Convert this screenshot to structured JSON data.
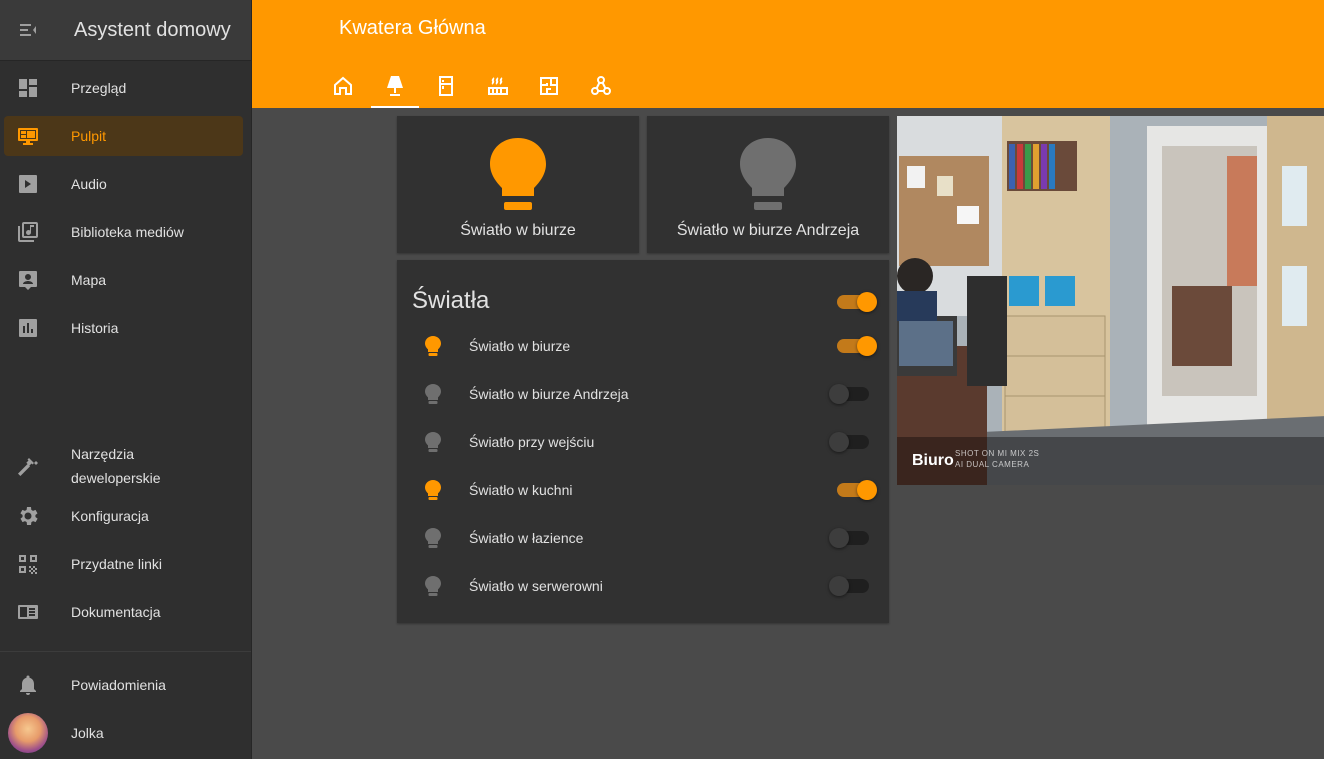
{
  "app": {
    "title": "Asystent domowy"
  },
  "sidebar": {
    "items": [
      {
        "label": "Przegląd",
        "icon": "dashboard-icon"
      },
      {
        "label": "Pulpit",
        "icon": "monitor-dashboard-icon",
        "active": true
      },
      {
        "label": "Audio",
        "icon": "play-box-icon"
      },
      {
        "label": "Biblioteka mediów",
        "icon": "library-music-icon"
      },
      {
        "label": "Mapa",
        "icon": "account-box-icon"
      },
      {
        "label": "Historia",
        "icon": "chart-box-icon"
      }
    ],
    "bottom_items": [
      {
        "label_line1": "Narzędzia",
        "label_line2": "deweloperskie",
        "icon": "hammer-icon"
      },
      {
        "label": "Konfiguracja",
        "icon": "gear-icon"
      },
      {
        "label": "Przydatne linki",
        "icon": "qrcode-icon"
      },
      {
        "label": "Dokumentacja",
        "icon": "book-icon"
      }
    ],
    "notifications": {
      "label": "Powiadomienia",
      "icon": "bell-icon"
    },
    "user": {
      "label": "Jolka",
      "icon": "avatar"
    }
  },
  "header": {
    "title": "Kwatera Główna",
    "tabs": [
      {
        "icon": "home-icon"
      },
      {
        "icon": "lamp-icon",
        "active": true
      },
      {
        "icon": "fridge-icon"
      },
      {
        "icon": "radiator-icon"
      },
      {
        "icon": "floor-plan-icon"
      },
      {
        "icon": "molecule-icon"
      }
    ]
  },
  "buttons": [
    {
      "label": "Światło w biurze",
      "state": "on"
    },
    {
      "label": "Światło w biurze Andrzeja",
      "state": "off"
    }
  ],
  "lights": {
    "title": "Światła",
    "all_on": true,
    "rows": [
      {
        "label": "Światło w biurze",
        "on": true
      },
      {
        "label": "Światło w biurze Andrzeja",
        "on": false
      },
      {
        "label": "Światło przy wejściu",
        "on": false
      },
      {
        "label": "Światło w kuchni",
        "on": true
      },
      {
        "label": "Światło w łazience",
        "on": false
      },
      {
        "label": "Światło w serwerowni",
        "on": false
      }
    ]
  },
  "camera": {
    "name": "Biuro",
    "watermark_line1": "SHOT ON MI MIX 2S",
    "watermark_line2": "AI DUAL CAMERA"
  },
  "colors": {
    "accent": "#ff9800",
    "sidebar": "#2f2f2f",
    "card": "#313131",
    "background": "#4a4a4a",
    "icon_off": "#6f6f6f"
  }
}
